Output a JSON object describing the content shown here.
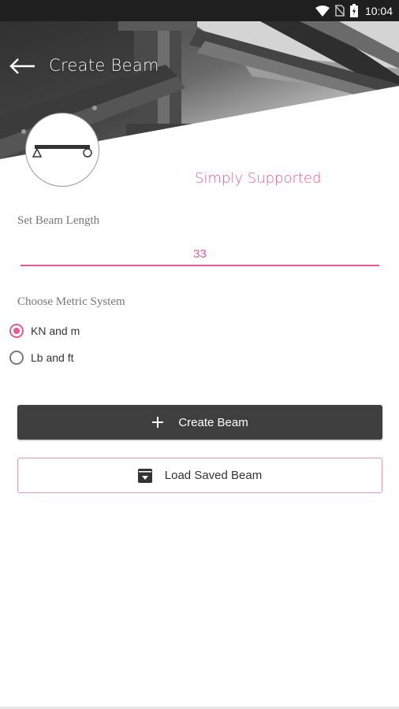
{
  "status_bar": {
    "time": "10:04"
  },
  "header": {
    "title": "Create Beam"
  },
  "beam": {
    "type_label": "Simply Supported"
  },
  "length": {
    "label": "Set Beam Length",
    "value": "33"
  },
  "metric": {
    "label": "Choose Metric System",
    "options": [
      {
        "label": "KN and m",
        "checked": true
      },
      {
        "label": "Lb and ft",
        "checked": false
      }
    ]
  },
  "actions": {
    "create_label": "Create Beam",
    "load_label": "Load Saved Beam"
  },
  "colors": {
    "accent": "#e8598f",
    "button_dark": "#3f3f3f",
    "status_bar": "#1f1f1f"
  }
}
